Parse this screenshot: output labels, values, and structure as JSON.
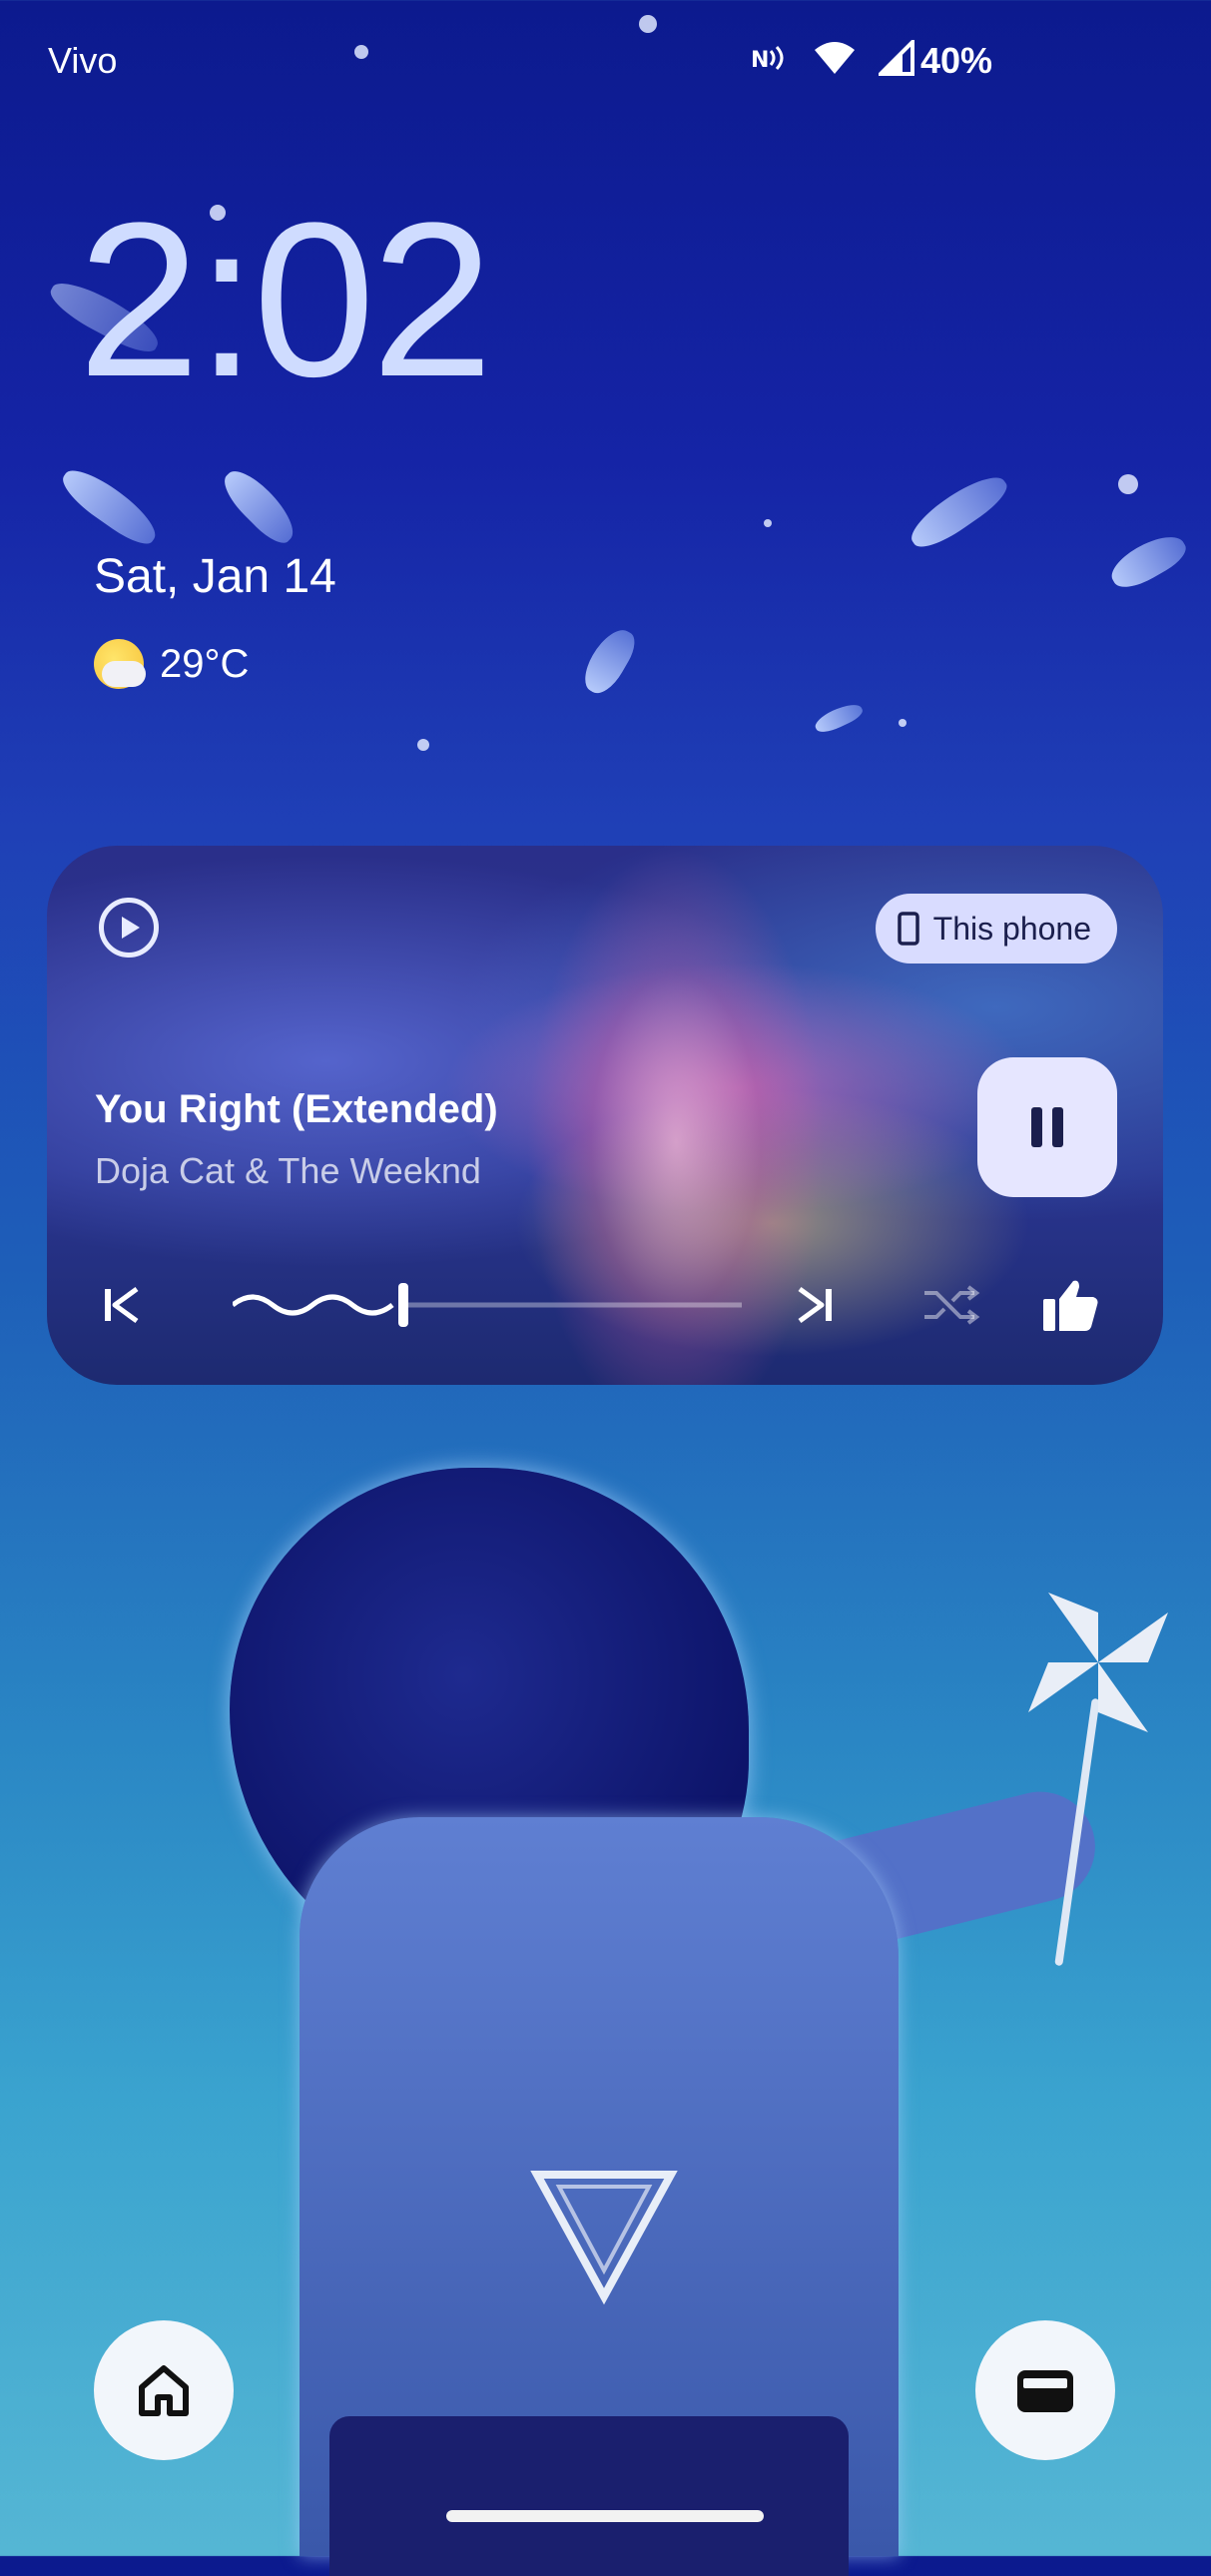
{
  "status_bar": {
    "carrier": "Vivo",
    "battery": "40%",
    "icons": [
      "nfc-icon",
      "wifi-icon",
      "signal-icon"
    ]
  },
  "lockscreen": {
    "time": "2:02",
    "date": "Sat, Jan 14",
    "weather": {
      "icon": "partly-cloudy-icon",
      "temperature": "29°C"
    }
  },
  "media_player": {
    "app_icon": "play-circle-icon",
    "output_device": "This phone",
    "track_title": "You Right (Extended)",
    "track_artist": "Doja Cat & The Weeknd",
    "state": "playing",
    "progress_fraction": 0.34,
    "controls": [
      "skip-previous-icon",
      "pause-icon",
      "skip-next-icon",
      "shuffle-icon",
      "thumbs-up-icon"
    ]
  },
  "shortcuts": {
    "left": "home-icon",
    "right": "wallet-icon"
  },
  "colors": {
    "accent_chip": "#d9dcff",
    "pause_button": "#e6e6ff",
    "clock": "#cfdcff"
  }
}
